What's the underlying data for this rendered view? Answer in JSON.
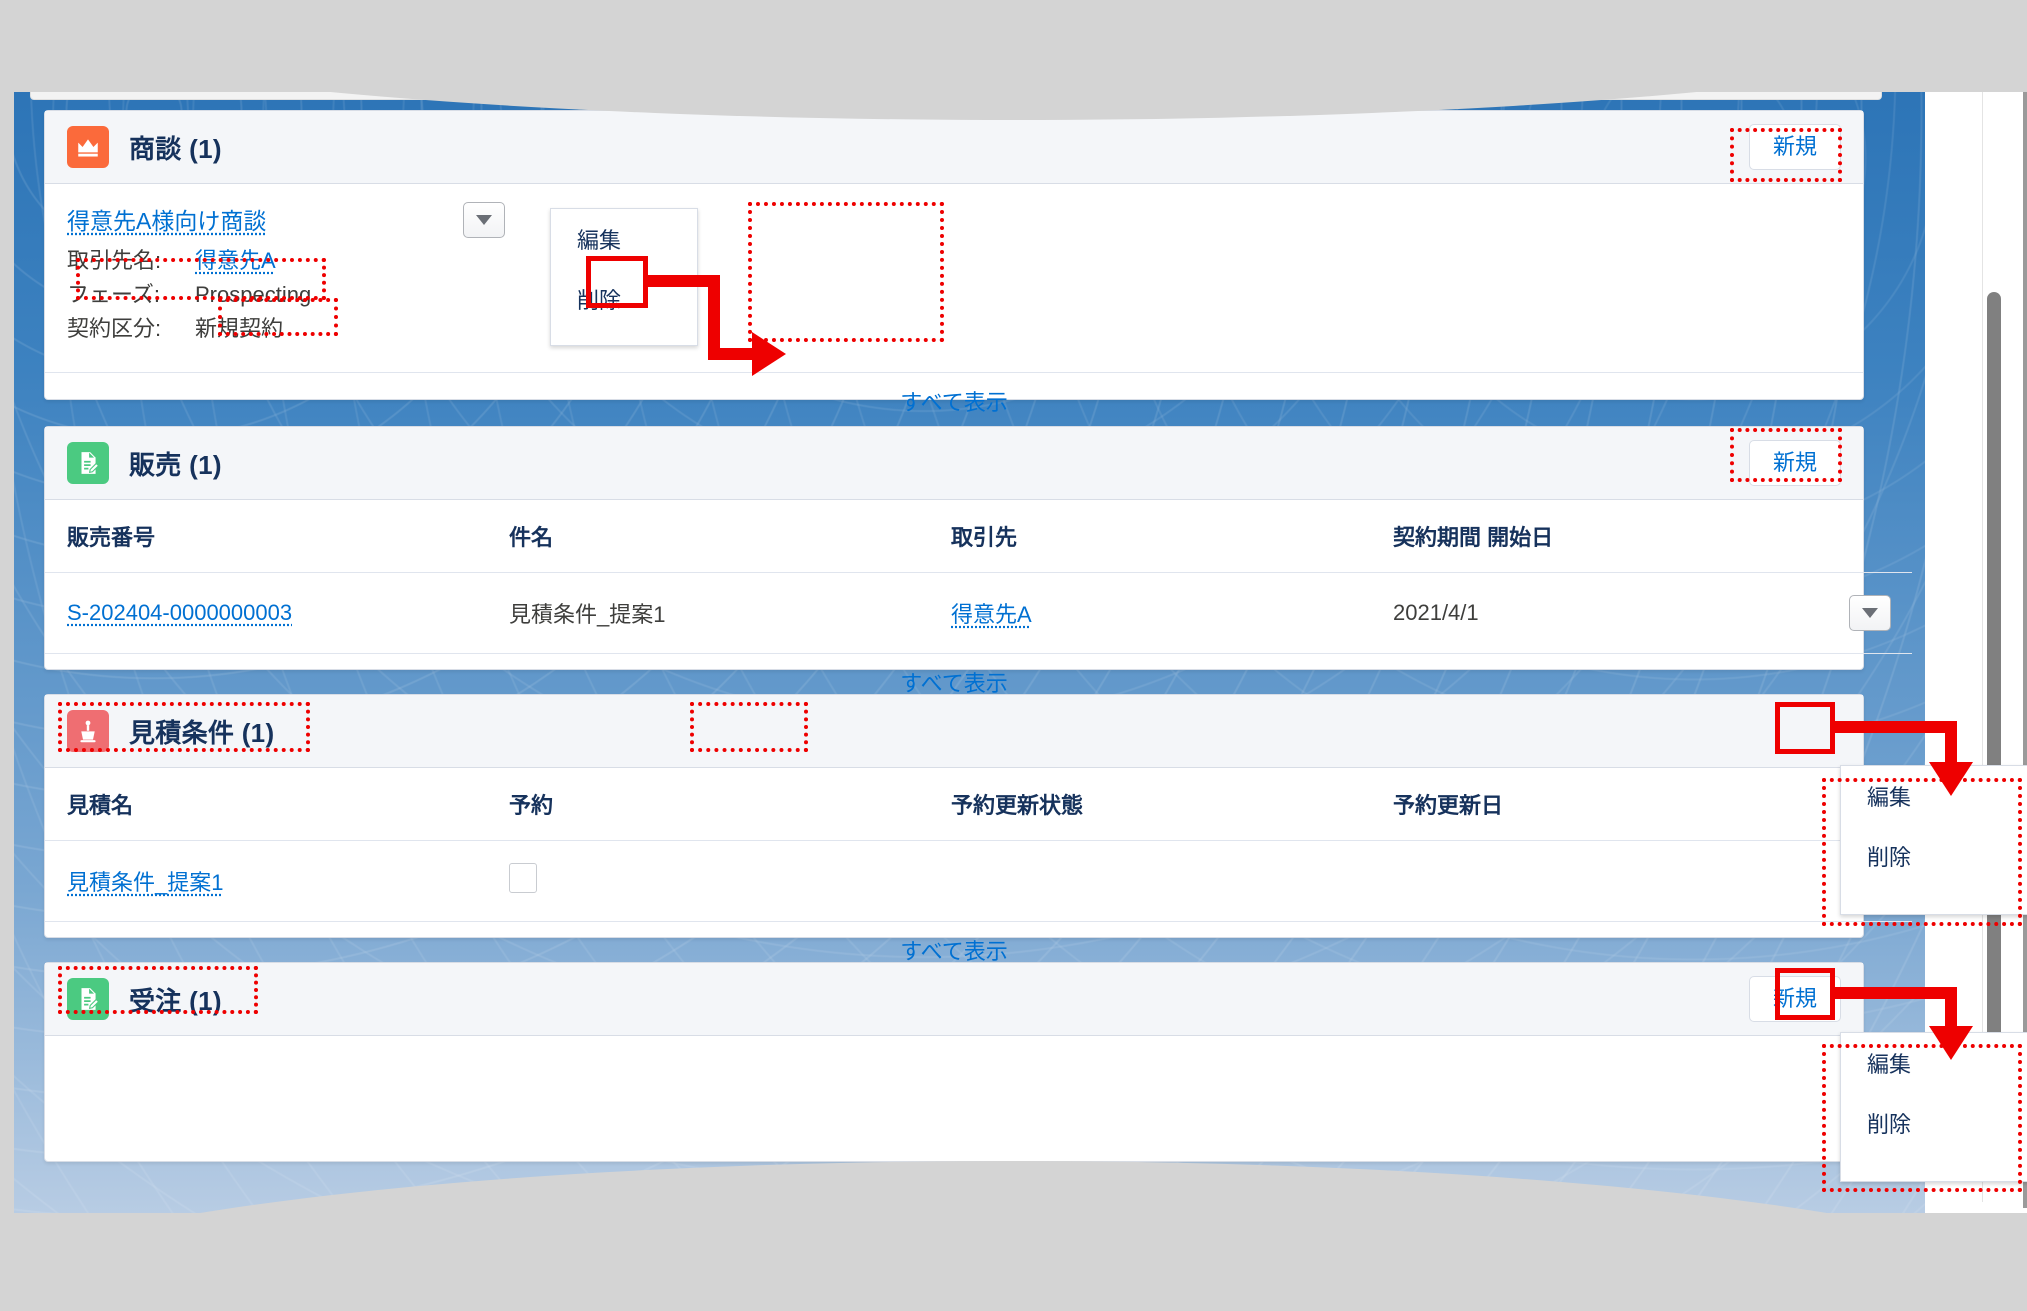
{
  "page": {
    "app": "Salesforce レコード詳細 関連リスト",
    "accent_link_color": "#0070d2",
    "annotation_color": "#ee0000"
  },
  "sections": [
    {
      "id": "opportunity",
      "icon": "crown-icon",
      "icon_color": "#fb6a3b",
      "title": "商談 (1)",
      "new_label": "新規",
      "layout": "compact",
      "record": {
        "title": "得意先A様向け商談",
        "fields": [
          {
            "label": "取引先名:",
            "value": "得意先A",
            "is_link": true
          },
          {
            "label": "フェーズ:",
            "value": "Prospecting",
            "is_link": false
          },
          {
            "label": "契約区分:",
            "value": "新規契約",
            "is_link": false
          }
        ]
      },
      "view_all": "すべて表示"
    },
    {
      "id": "sales",
      "icon": "document-edit-icon",
      "icon_color": "#4bca81",
      "title": "販売 (1)",
      "new_label": "新規",
      "layout": "table",
      "columns": [
        "販売番号",
        "件名",
        "取引先",
        "契約期間 開始日"
      ],
      "rows": [
        {
          "cells": [
            {
              "text": "S-202404-0000000003",
              "is_link": true
            },
            {
              "text": "見積条件_提案1",
              "is_link": false
            },
            {
              "text": "得意先A",
              "is_link": true
            },
            {
              "text": "2021/4/1",
              "is_link": false
            }
          ]
        }
      ],
      "view_all": "すべて表示"
    },
    {
      "id": "quote-condition",
      "icon": "quote-icon",
      "icon_color": "#ef6e72",
      "title": "見積条件 (1)",
      "new_label": "",
      "layout": "table",
      "columns": [
        "見積名",
        "予約",
        "予約更新状態",
        "予約更新日"
      ],
      "rows": [
        {
          "cells": [
            {
              "text": "見積条件_提案1",
              "is_link": true
            },
            {
              "text": "",
              "is_link": false,
              "is_checkbox": true
            },
            {
              "text": "",
              "is_link": false
            },
            {
              "text": "",
              "is_link": false
            }
          ]
        }
      ],
      "view_all": "すべて表示"
    },
    {
      "id": "order",
      "icon": "document-edit-icon",
      "icon_color": "#4bca81",
      "title": "受注 (1)",
      "new_label": "新規",
      "layout": "header-only",
      "columns": [],
      "rows": [],
      "view_all": ""
    }
  ],
  "menus": [
    {
      "id": "opportunity-row-menu",
      "items": [
        "編集",
        "削除"
      ]
    },
    {
      "id": "sales-row-menu",
      "items": [
        "編集",
        "削除"
      ]
    },
    {
      "id": "quote-row-menu",
      "items": [
        "編集",
        "削除"
      ]
    }
  ],
  "row_action": {
    "icon": "chevron-down-icon",
    "aria_label": "アクションを表示"
  },
  "scrollbar": {
    "orientation": "vertical"
  }
}
